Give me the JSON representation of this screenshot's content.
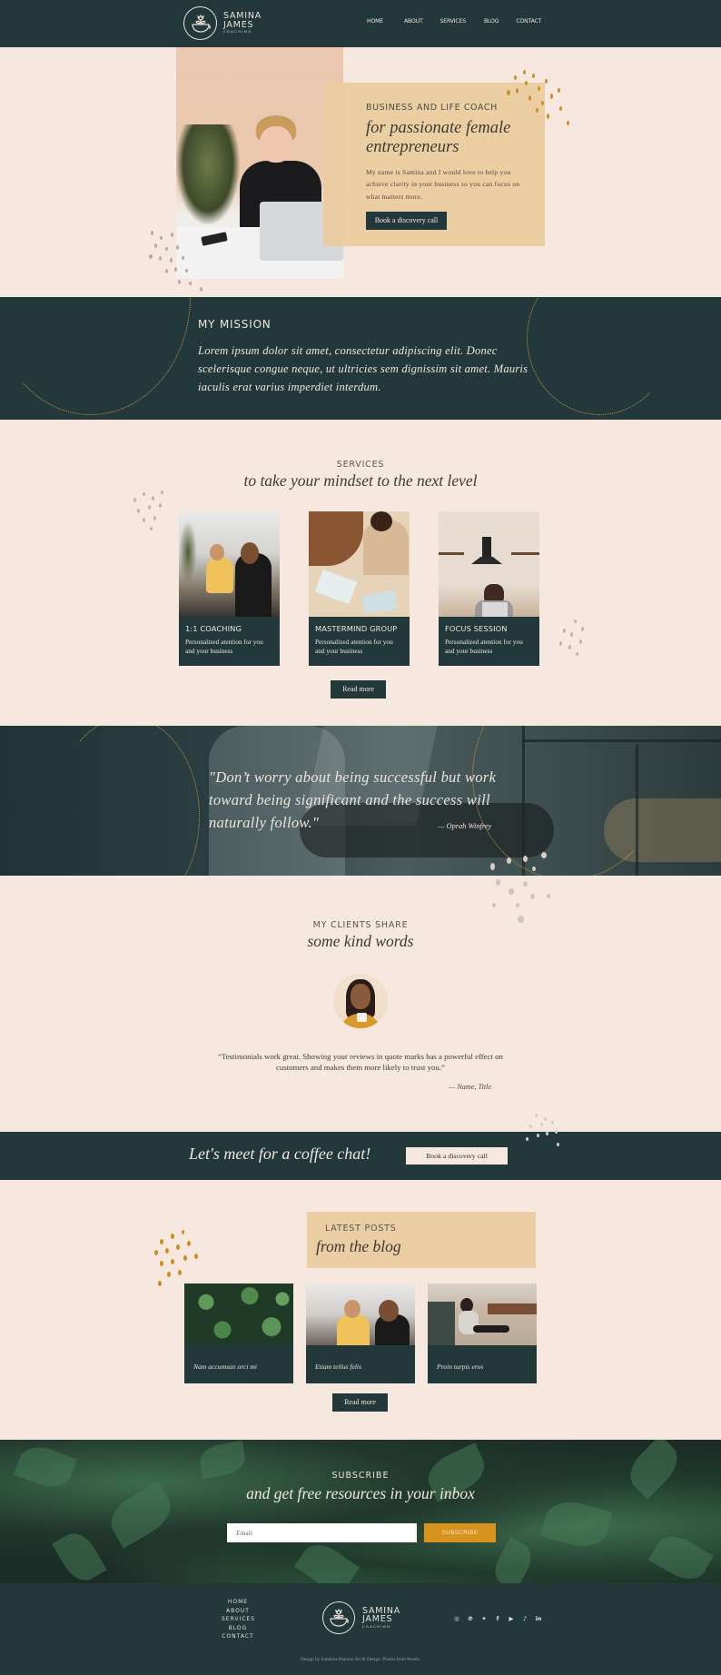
{
  "brand": {
    "name_line1": "SAMINA",
    "name_line2": "JAMES",
    "tagline": "COACHING",
    "logo_icon": "flower-cup-icon"
  },
  "nav": {
    "items": [
      "HOME",
      "ABOUT",
      "SERVICES",
      "BLOG",
      "CONTACT"
    ]
  },
  "hero": {
    "kicker": "BUSINESS AND LIFE COACH",
    "title": "for passionate female entrepreneurs",
    "body": "My name is Samina and I would love to help you achieve clarity in your business so you can focus on what matters more.",
    "cta": "Book a discovery call"
  },
  "mission": {
    "heading": "MY MISSION",
    "body": "Lorem ipsum dolor sit amet, consectetur adipiscing elit. Donec scelerisque congue neque, ut ultricies sem dignissim sit amet. Mauris iaculis erat varius imperdiet interdum."
  },
  "services": {
    "kicker": "SERVICES",
    "title": "to take your mindset to the next level",
    "cards": [
      {
        "title": "1:1 COACHING",
        "desc": "Personalized atention for you and your business"
      },
      {
        "title": "MASTERMIND GROUP",
        "desc": "Personalized atention for you and your business"
      },
      {
        "title": "FOCUS SESSION",
        "desc": "Personalized atention for you and your business"
      }
    ],
    "read_more": "Read more"
  },
  "quote": {
    "text": "\"Don’t worry about being successful but work toward being significant and the success will naturally follow.\"",
    "author": "— Oprah Winfrey"
  },
  "testimonials": {
    "kicker": "MY CLIENTS SHARE",
    "title": "some kind words",
    "quote": "“Testimonials work great. Showing your reviews in quote marks has a powerful effect on customers and makes them more likely to trust you.”",
    "attribution": "— Name, Title"
  },
  "coffee": {
    "title": "Let's meet for a coffee chat!",
    "cta": "Book a discovery call"
  },
  "blog": {
    "kicker": "LATEST POSTS",
    "title": "from the blog",
    "posts": [
      {
        "title": "Nam accumsan orci mi"
      },
      {
        "title": "Etiam tellus felis"
      },
      {
        "title": "Proin turpis eros"
      }
    ],
    "read_more": "Read more"
  },
  "subscribe": {
    "kicker": "SUBSCRIBE",
    "title": "and get free resources in your inbox",
    "email_placeholder": "Email",
    "email_value": "",
    "button": "SUBSCRIBE"
  },
  "footer": {
    "nav": [
      "HOME",
      "ABOUT",
      "SERVICES",
      "BLOG",
      "CONTACT"
    ],
    "social": [
      {
        "name": "instagram-icon",
        "glyph": "◎"
      },
      {
        "name": "pinterest-icon",
        "glyph": "℗"
      },
      {
        "name": "twitter-icon",
        "glyph": "✦"
      },
      {
        "name": "facebook-icon",
        "glyph": "f"
      },
      {
        "name": "youtube-icon",
        "glyph": "▶"
      },
      {
        "name": "tiktok-icon",
        "glyph": "♪"
      },
      {
        "name": "linkedin-icon",
        "glyph": "in"
      }
    ],
    "credit": "Design by Sombras Blancas Art & Design. Photos from Pexels."
  },
  "colors": {
    "dark_teal": "#22383b",
    "blush": "#f6e8df",
    "sand": "#eacda3",
    "gold": "#d6941f",
    "cream_text": "#efe6dd"
  }
}
